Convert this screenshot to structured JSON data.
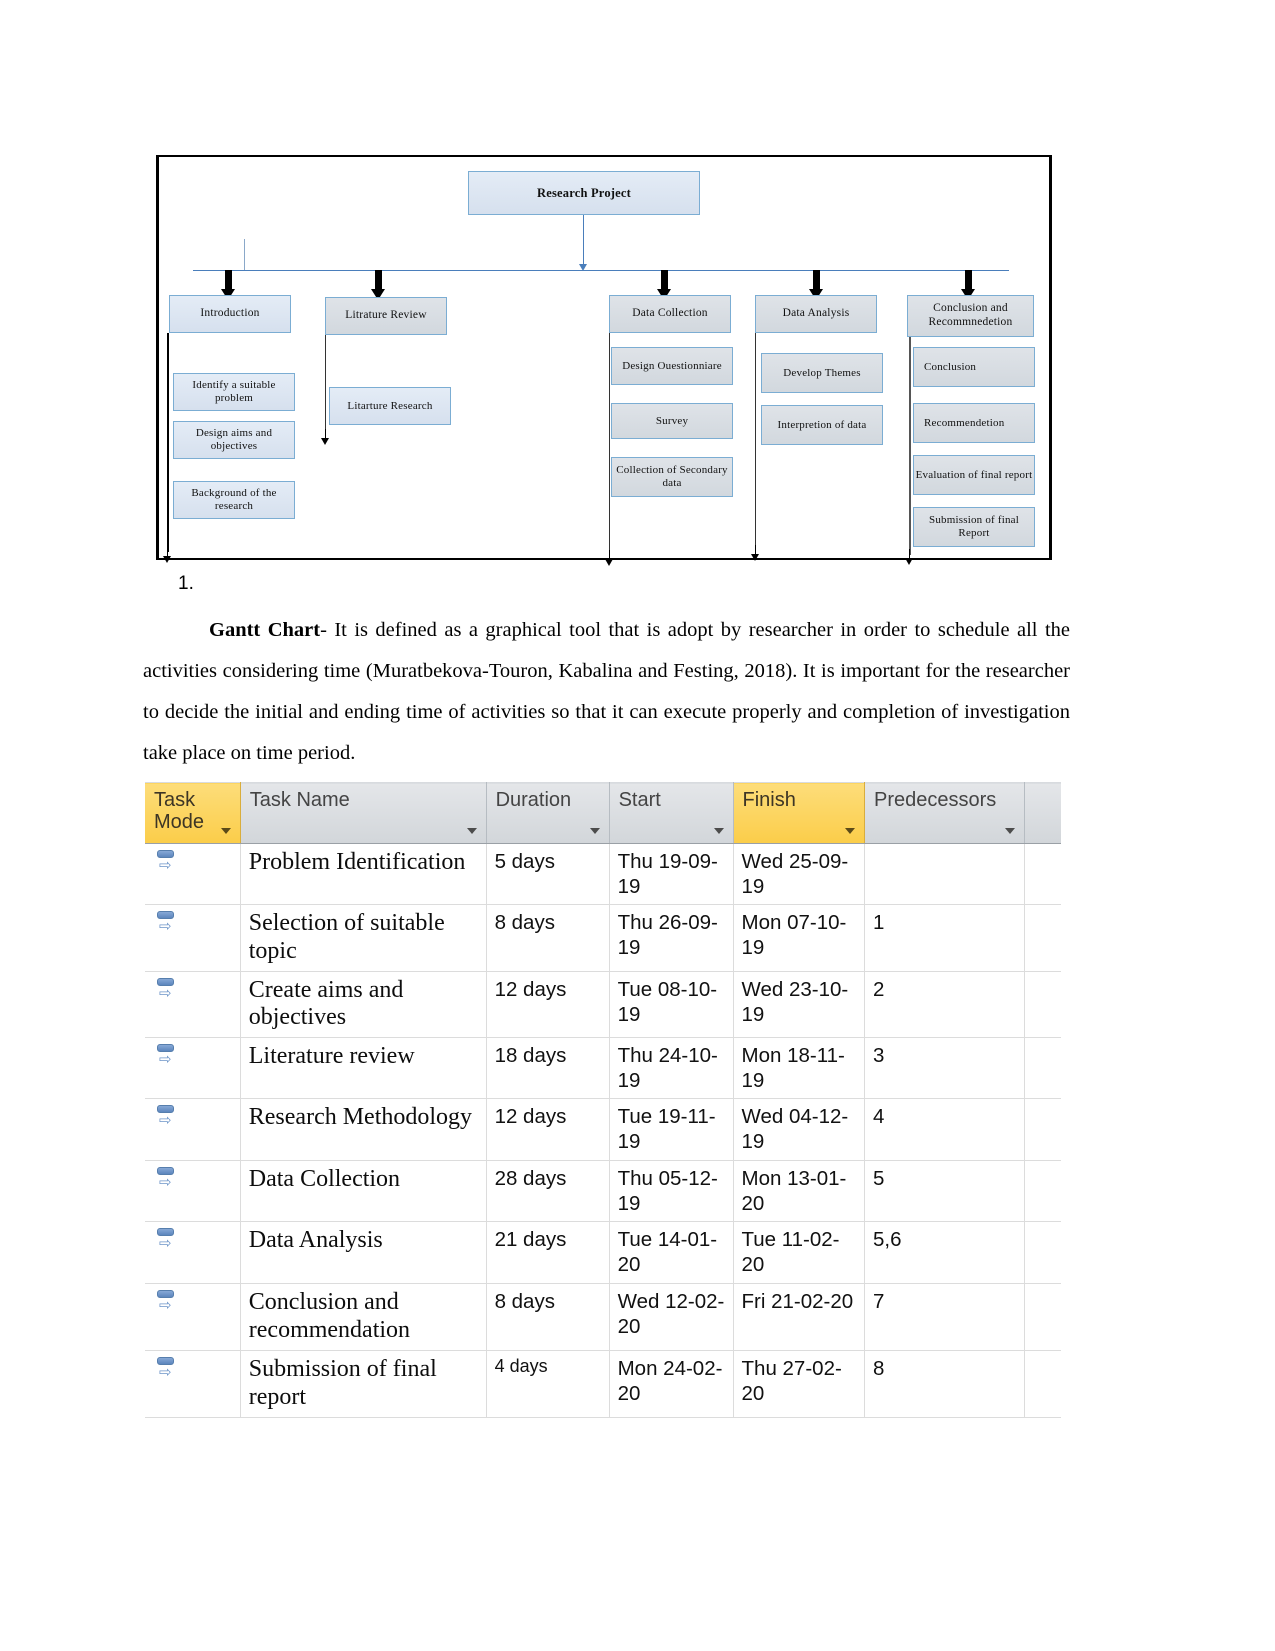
{
  "flowchart": {
    "root": {
      "label": "Research Project"
    },
    "branches": [
      {
        "label": "Introduction",
        "children": [
          "Identify a suitable problem",
          "Design aims and objectives",
          "Background of the research"
        ]
      },
      {
        "label": "Litrature Review",
        "children": [
          "Litarture Research"
        ]
      },
      {
        "label": "Data Collection",
        "children": [
          "Design Ouestionniare",
          "Survey",
          "Collection of Secondary data"
        ]
      },
      {
        "label": "Data Analysis",
        "children": [
          "Develop Themes",
          "Interpretion of data"
        ]
      },
      {
        "label": "Conclusion and Recommnedetion",
        "children": [
          "Conclusion",
          "Recommendetion",
          "Evaluation of final report",
          "Submission of final Report"
        ]
      }
    ],
    "colors": {
      "node_fill": "#dce6f1",
      "node_fill_gray": "#dbdfe4",
      "node_border": "#7badd3",
      "connector": "#4a7ebb"
    }
  },
  "body": {
    "list_number": "1.",
    "term": "Gantt Chart",
    "text": "- It is defined as a graphical tool that is adopt by researcher in order to schedule all the activities considering time (Muratbekova-Touron, Kabalina and Festing, 2018). It is important for the researcher to decide the initial and ending time of activities so that it can execute properly and completion of investigation take place on time period."
  },
  "project_table": {
    "headers": [
      {
        "label": "Task Mode",
        "highlighted": true
      },
      {
        "label": "Task Name",
        "highlighted": false
      },
      {
        "label": "Duration",
        "highlighted": false
      },
      {
        "label": "Start",
        "highlighted": false
      },
      {
        "label": "Finish",
        "highlighted": true
      },
      {
        "label": "Predecessors",
        "highlighted": false
      }
    ],
    "header_highlight_color": "#fbcd49",
    "header_normal_color": "#d9dde1",
    "mode_icon": "auto-schedule-icon",
    "rows": [
      {
        "task": "Problem Identification",
        "duration": "5 days",
        "start": "Thu 19-09-19",
        "finish": "Wed 25-09-19",
        "predecessors": ""
      },
      {
        "task": "Selection of suitable topic",
        "duration": "8 days",
        "start": "Thu 26-09-19",
        "finish": "Mon 07-10-19",
        "predecessors": "1"
      },
      {
        "task": "Create aims and objectives",
        "duration": "12 days",
        "start": "Tue 08-10-19",
        "finish": "Wed 23-10-19",
        "predecessors": "2"
      },
      {
        "task": "Literature review",
        "duration": "18 days",
        "start": "Thu 24-10-19",
        "finish": "Mon 18-11-19",
        "predecessors": "3"
      },
      {
        "task": "Research Methodology",
        "duration": "12 days",
        "start": "Tue 19-11-19",
        "finish": "Wed 04-12-19",
        "predecessors": "4"
      },
      {
        "task": "Data Collection",
        "duration": "28 days",
        "start": "Thu 05-12-19",
        "finish": "Mon 13-01-20",
        "predecessors": "5"
      },
      {
        "task": "Data Analysis",
        "duration": "21 days",
        "start": "Tue 14-01-20",
        "finish": "Tue 11-02-20",
        "predecessors": "5,6"
      },
      {
        "task": "Conclusion and recommendation",
        "duration": "8 days",
        "start": "Wed 12-02-20",
        "finish": "Fri 21-02-20",
        "predecessors": "7"
      },
      {
        "task": "Submission of final report",
        "duration": "4 days",
        "start": "Mon 24-02-20",
        "finish": "Thu 27-02-20",
        "predecessors": "8"
      }
    ]
  }
}
